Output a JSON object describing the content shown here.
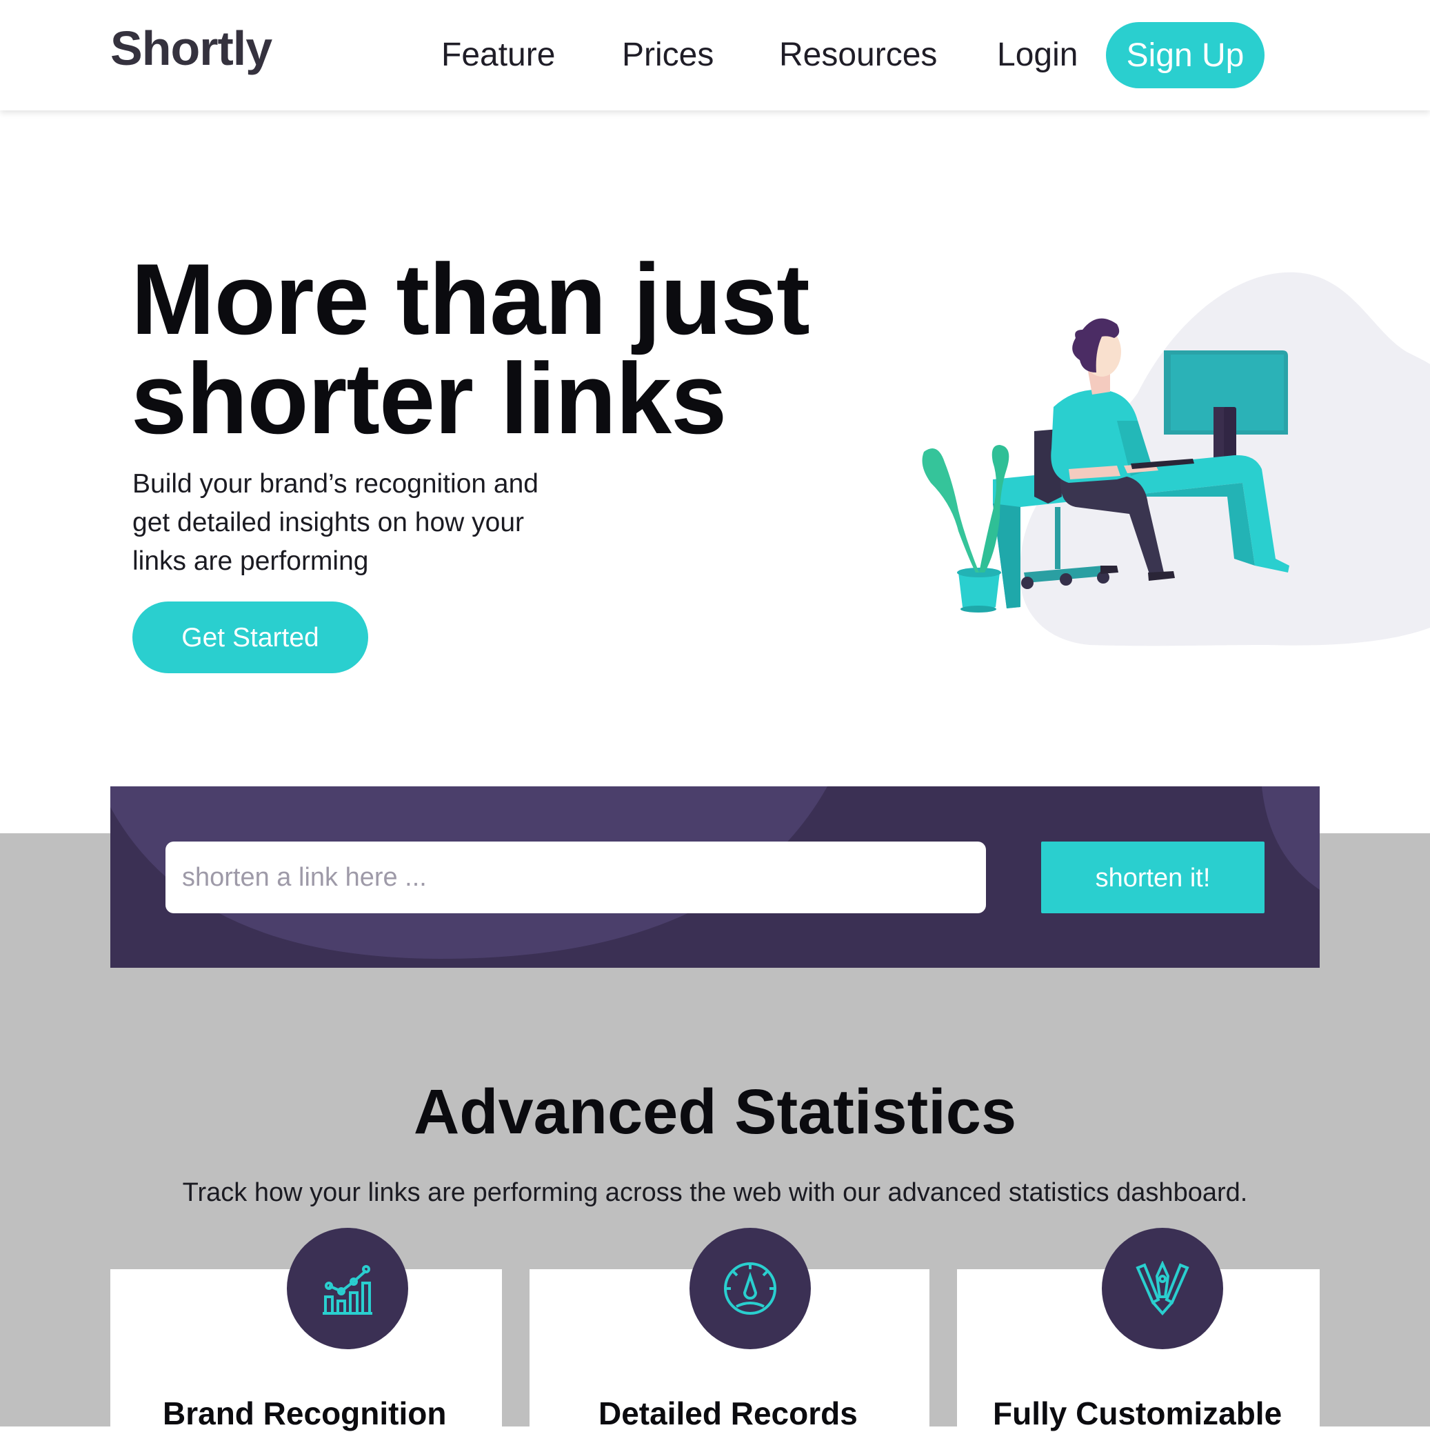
{
  "header": {
    "logo": "Shortly",
    "nav": {
      "feature": "Feature",
      "prices": "Prices",
      "resources": "Resources",
      "login": "Login"
    },
    "signup_label": "Sign Up"
  },
  "hero": {
    "title_line1": "More than just",
    "title_line2": "shorter links",
    "subtitle": "Build your brand’s recognition and get detailed insights on how your links are performing",
    "cta_label": "Get Started"
  },
  "shorten": {
    "placeholder": "shorten a link here ...",
    "button_label": "shorten it!"
  },
  "stats": {
    "title": "Advanced Statistics",
    "subtitle": "Track how your links are performing across the web with our advanced statistics dashboard.",
    "cards": [
      {
        "title": "Brand Recognition",
        "icon": "bar-chart-icon"
      },
      {
        "title": "Detailed Records",
        "icon": "gauge-icon"
      },
      {
        "title": "Fully Customizable",
        "icon": "design-tools-icon"
      }
    ]
  },
  "colors": {
    "accent": "#2acfcf",
    "dark_violet": "#3b3054",
    "gray_background": "#bfbfbf",
    "text_dark": "#35323e"
  }
}
